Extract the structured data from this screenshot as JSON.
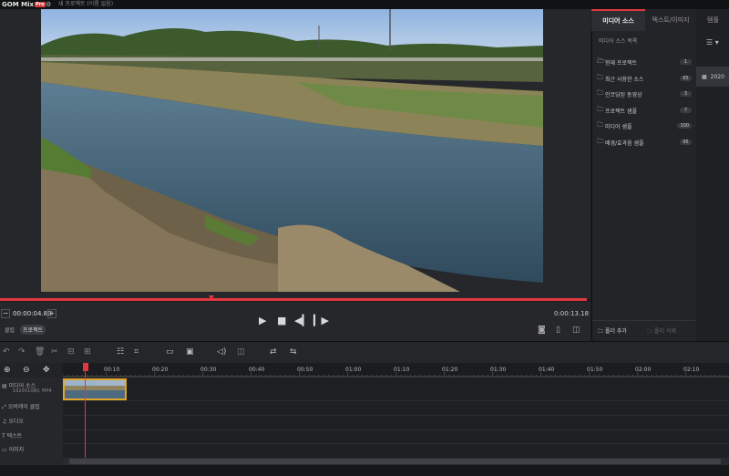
{
  "titlebar": {
    "logo_text": "GOM Mix",
    "logo_badge": "Pro",
    "gear_icon": "gear-icon",
    "project_title": "새 프로젝트 (이름 없음)"
  },
  "preview": {
    "current_time": "00:00:04.80",
    "total_time": "0:00:13.18",
    "progress": 0.36,
    "tabs": {
      "clip": "클립",
      "project": "프로젝트"
    }
  },
  "right_panel": {
    "tab_media": "미디어 소스",
    "tab_text": "텍스트/이미지",
    "tab_template": "템플",
    "list_header": "미디어 소스 목록",
    "items": [
      {
        "label": "현재 프로젝트",
        "count": "1",
        "icon": "folder-open-icon"
      },
      {
        "label": "최근 사용한 소스",
        "count": "65",
        "icon": "folder-icon"
      },
      {
        "label": "인코딩된 동영상",
        "count": "3",
        "icon": "folder-export-icon"
      },
      {
        "label": "프로젝트 샘플",
        "count": "7",
        "icon": "folder-icon"
      },
      {
        "label": "미디어 샘플",
        "count": "100",
        "icon": "folder-icon"
      },
      {
        "label": "배경/효과음 샘플",
        "count": "95",
        "icon": "folder-icon"
      }
    ],
    "folder_add": "폴더 추가",
    "folder_delete": "폴더 삭제",
    "thumb_label": "2020"
  },
  "timeline": {
    "ticks": [
      "00:10",
      "00:20",
      "00:30",
      "00:40",
      "00:50",
      "01:00",
      "01:10",
      "01:20",
      "01:30",
      "01:40",
      "01:50",
      "02:00",
      "02:10"
    ],
    "tracks": [
      {
        "label": "미디어 소스",
        "sub": "1920X1080, MP4",
        "icon": "film-icon"
      },
      {
        "label": "오버레이 클립",
        "icon": "overlay-icon"
      },
      {
        "label": "오디오",
        "icon": "music-note-icon"
      },
      {
        "label": "텍스트",
        "icon": "text-icon"
      },
      {
        "label": "이미지",
        "icon": "image-icon"
      }
    ]
  },
  "colors": {
    "accent": "#e3373d",
    "clip_border": "#e0a62a",
    "background": "#1c1d20"
  }
}
